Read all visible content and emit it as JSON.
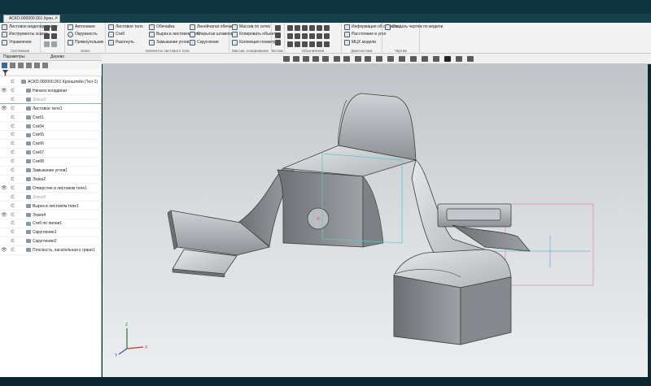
{
  "window": {
    "document_tab": "АСКО.000000.001 Крон..."
  },
  "ribbon": {
    "groups": [
      {
        "label": "Системная",
        "items": [
          "Листовое моделирование",
          "Инструменты эскиза",
          "Управление"
        ]
      },
      {
        "label": "Эскиз",
        "items": [
          "Автолиния",
          "Окружность",
          "Прямоугольник"
        ]
      },
      {
        "label": "Элементы листового тела",
        "items": [
          "Листовое тело",
          "Сгиб",
          "Разогнуть",
          "Обечайка",
          "Вырез в листовом теле",
          "Замыкание углов",
          "Линейчатая обечайка",
          "Открытая штамповка",
          "Скругление"
        ]
      },
      {
        "label": "Массив, копирование",
        "items": [
          "Массив по сетке",
          "Копировать объекты",
          "Коллекция геометрии"
        ]
      },
      {
        "label": "Вспом...",
        "items": []
      },
      {
        "label": "Обозначения",
        "items": []
      },
      {
        "label": "Диагностика",
        "items": [
          "Информация об объекте",
          "Расстояние и угол",
          "МЦХ модели"
        ]
      },
      {
        "label": "Чертеж",
        "items": [
          "Создать чертеж по модели"
        ]
      }
    ]
  },
  "panel": {
    "tabs": [
      "Параметры",
      "Дерево"
    ],
    "rows": [
      {
        "eye": "",
        "label": "АСКО.000000.001 Кронштейн (Тел-1)",
        "indent": 1,
        "dim": false
      },
      {
        "eye": "👁",
        "label": "Начало координат",
        "indent": 2,
        "dim": false
      },
      {
        "eye": "",
        "label": "ЭскизЗ",
        "indent": 2,
        "dim": true
      },
      {
        "eye": "👁",
        "label": "Листовое тело1",
        "indent": 2,
        "dim": false
      },
      {
        "eye": "",
        "label": "Сгиб1",
        "indent": 2,
        "dim": false
      },
      {
        "eye": "",
        "label": "Сгиб4",
        "indent": 2,
        "dim": false
      },
      {
        "eye": "",
        "label": "Сгиб5",
        "indent": 2,
        "dim": false
      },
      {
        "eye": "",
        "label": "Сгиб6",
        "indent": 2,
        "dim": false
      },
      {
        "eye": "",
        "label": "Сгиб7",
        "indent": 2,
        "dim": false
      },
      {
        "eye": "",
        "label": "Сгиб8",
        "indent": 2,
        "dim": false
      },
      {
        "eye": "",
        "label": "Замыкание углов1",
        "indent": 2,
        "dim": false
      },
      {
        "eye": "",
        "label": "Эскиз2",
        "indent": 2,
        "dim": false
      },
      {
        "eye": "👁",
        "label": "Отверстие в листовом теле1",
        "indent": 2,
        "dim": false
      },
      {
        "eye": "",
        "label": "Эскиз3",
        "indent": 2,
        "dim": true
      },
      {
        "eye": "",
        "label": "Вырез в листовом теле1",
        "indent": 2,
        "dim": false
      },
      {
        "eye": "👁",
        "label": "Эскиз4",
        "indent": 2,
        "dim": false
      },
      {
        "eye": "",
        "label": "Сгиб по линии1",
        "indent": 2,
        "dim": false
      },
      {
        "eye": "",
        "label": "Скругление1",
        "indent": 2,
        "dim": false
      },
      {
        "eye": "",
        "label": "Скругление2",
        "indent": 2,
        "dim": false
      },
      {
        "eye": "👁",
        "label": "Плоскость, касательная к грани1",
        "indent": 2,
        "dim": false
      }
    ]
  },
  "viewport": {
    "triad_labels": [
      "X",
      "Y",
      "Z"
    ]
  }
}
